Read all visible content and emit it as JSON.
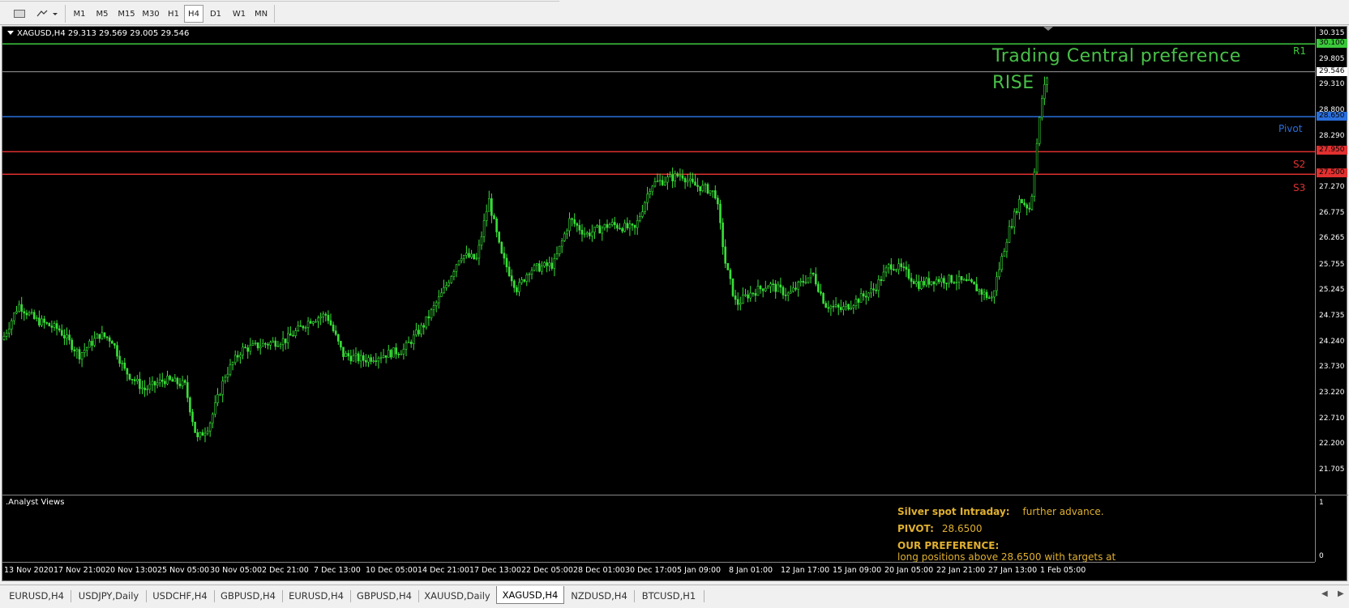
{
  "toolbar": {
    "timeframes": [
      "M1",
      "M5",
      "M15",
      "M30",
      "H1",
      "H4",
      "D1",
      "W1",
      "MN"
    ],
    "active_timeframe": "H4"
  },
  "chart": {
    "header": "XAGUSD,H4  29.313 29.569 29.005 29.546",
    "overlay_title": "Trading Central preference",
    "overlay_signal": "RISE",
    "levels": [
      {
        "name": "R1",
        "price": 30.1,
        "tag": "30.100",
        "color": "#3cc83c"
      },
      {
        "name": "Pivot",
        "price": 28.65,
        "tag": "28.650",
        "color": "#2a6fdc"
      },
      {
        "name": "S2",
        "price": 27.95,
        "tag": "27.950",
        "color": "#e03030"
      },
      {
        "name": "S3",
        "price": 27.5,
        "tag": "27.500",
        "color": "#e03030"
      }
    ],
    "current_price": 29.546,
    "current_tag": "29.546",
    "price_ticks": [
      "30.315",
      "29.805",
      "29.310",
      "28.800",
      "28.290",
      "27.270",
      "26.775",
      "26.265",
      "25.755",
      "25.245",
      "24.735",
      "24.240",
      "23.730",
      "23.220",
      "22.710",
      "22.200",
      "21.705"
    ],
    "time_labels": [
      "13 Nov 2020",
      "17 Nov 21:00",
      "20 Nov 13:00",
      "25 Nov 05:00",
      "30 Nov 05:00",
      "2 Dec 21:00",
      "7 Dec 13:00",
      "10 Dec 05:00",
      "14 Dec 21:00",
      "17 Dec 13:00",
      "22 Dec 05:00",
      "28 Dec 01:00",
      "30 Dec 17:00",
      "5 Jan 09:00",
      "8 Jan 01:00",
      "12 Jan 17:00",
      "15 Jan 09:00",
      "20 Jan 05:00",
      "22 Jan 21:00",
      "27 Jan 13:00",
      "1 Feb 05:00"
    ],
    "candle_color": "#38e038",
    "axis_min": 21.705,
    "axis_max": 30.315
  },
  "indicator": {
    "title": ".Analyst Views",
    "axis_top": "1",
    "axis_bottom": "0",
    "headline_label": "Silver spot Intraday:",
    "headline_text": "further advance.",
    "pivot_label": "PIVOT:",
    "pivot_value": "28.6500",
    "preference_label": "OUR PREFERENCE:",
    "preference_text": "long positions above 28.6500 with targets at"
  },
  "tabs": {
    "items": [
      "EURUSD,H4",
      "USDJPY,Daily",
      "USDCHF,H4",
      "GBPUSD,H4",
      "EURUSD,H4",
      "GBPUSD,H4",
      "XAUUSD,Daily",
      "XAGUSD,H4",
      "NZDUSD,H4",
      "BTCUSD,H1"
    ],
    "active": "XAGUSD,H4"
  }
}
